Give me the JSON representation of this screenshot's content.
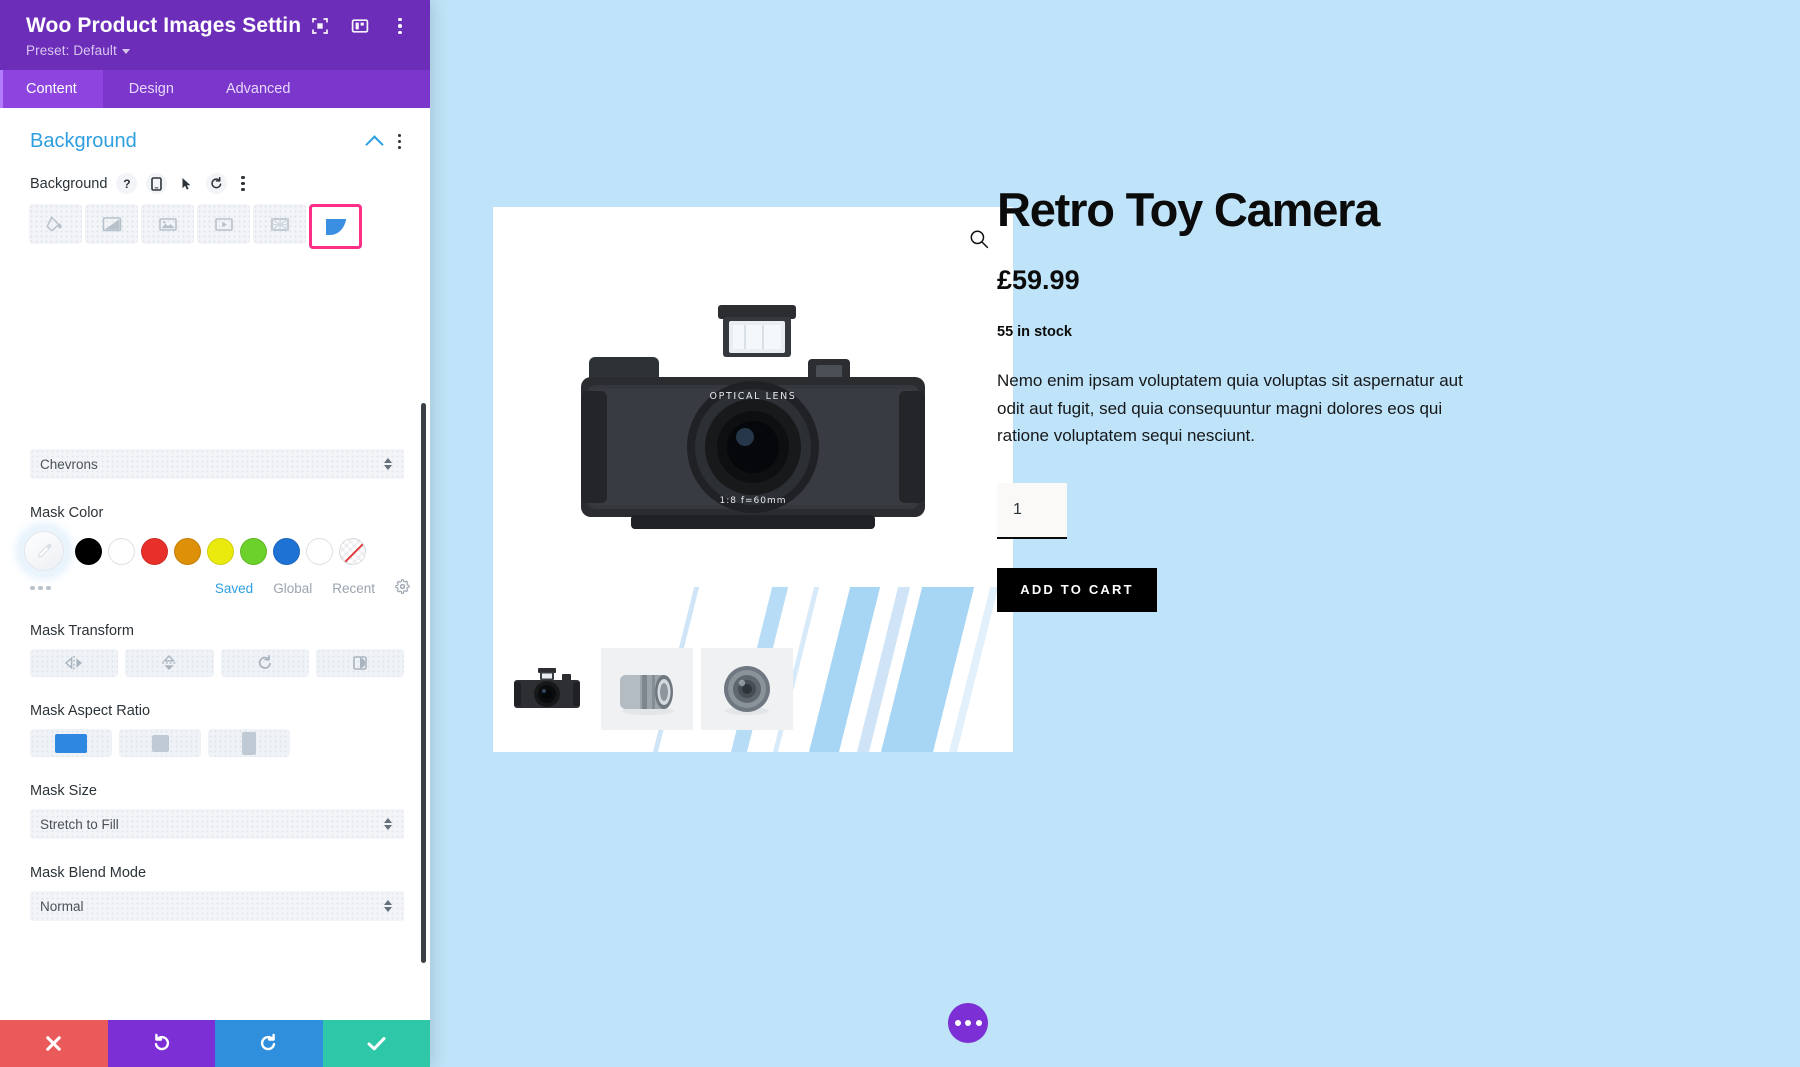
{
  "panel": {
    "title": "Woo Product Images Settin...",
    "preset_label": "Preset: Default",
    "header_icons": [
      "expand-icon",
      "layout-icon",
      "kebab-icon"
    ],
    "tabs": [
      {
        "label": "Content",
        "active": true
      },
      {
        "label": "Design",
        "active": false
      },
      {
        "label": "Advanced",
        "active": false
      }
    ],
    "section": {
      "title": "Background",
      "field_label": "Background",
      "field_icons": [
        "help-icon",
        "responsive-icon",
        "hover-icon",
        "reset-icon",
        "kebab-icon"
      ],
      "background_types": [
        {
          "name": "background-color",
          "active": false
        },
        {
          "name": "background-gradient",
          "active": false
        },
        {
          "name": "background-image",
          "active": false
        },
        {
          "name": "background-video",
          "active": false
        },
        {
          "name": "background-pattern",
          "active": false
        },
        {
          "name": "background-mask",
          "active": true
        }
      ]
    },
    "mask_style": {
      "label": "Chevrons"
    },
    "mask_color": {
      "label": "Mask Color",
      "swatches": [
        {
          "name": "eyedropper",
          "color": "#f2f4f7",
          "selected": true
        },
        {
          "name": "black",
          "color": "#000000"
        },
        {
          "name": "white",
          "color": "#ffffff"
        },
        {
          "name": "red",
          "color": "#e8302a"
        },
        {
          "name": "orange",
          "color": "#dd9008"
        },
        {
          "name": "yellow",
          "color": "#eaea0e"
        },
        {
          "name": "green",
          "color": "#6cd12a"
        },
        {
          "name": "blue",
          "color": "#1e72d4"
        },
        {
          "name": "white-2",
          "color": "#ffffff"
        },
        {
          "name": "transparent",
          "color": "transparent"
        }
      ],
      "tabs": [
        {
          "label": "Saved",
          "active": true
        },
        {
          "label": "Global",
          "active": false
        },
        {
          "label": "Recent",
          "active": false
        }
      ],
      "settings_icon": "gear-icon"
    },
    "mask_transform": {
      "label": "Mask Transform",
      "buttons": [
        "flip-horizontal-icon",
        "flip-vertical-icon",
        "rotate-icon",
        "invert-icon"
      ]
    },
    "mask_aspect_ratio": {
      "label": "Mask Aspect Ratio",
      "options": [
        {
          "name": "landscape",
          "active": true
        },
        {
          "name": "square",
          "active": false
        },
        {
          "name": "portrait",
          "active": false
        }
      ]
    },
    "mask_size": {
      "label": "Mask Size",
      "value": "Stretch to Fill"
    },
    "mask_blend_mode": {
      "label": "Mask Blend Mode",
      "value": "Normal"
    },
    "footer": [
      {
        "name": "discard-button",
        "icon": "close-icon",
        "color": "#eb5a5a"
      },
      {
        "name": "undo-button",
        "icon": "undo-icon",
        "color": "#7b2fd4"
      },
      {
        "name": "redo-button",
        "icon": "redo-icon",
        "color": "#2f8fdc"
      },
      {
        "name": "save-button",
        "icon": "check-icon",
        "color": "#2ec7a8"
      }
    ]
  },
  "canvas": {
    "background_color": "#bfe3f8",
    "gallery": {
      "zoom_icon": "magnifier-icon",
      "thumbnails": [
        "camera-thumb",
        "lens-thumb",
        "lens-cap-thumb"
      ]
    },
    "product": {
      "title": "Retro Toy Camera",
      "price": "£59.99",
      "stock": "55 in stock",
      "description": "Nemo enim ipsam voluptatem quia voluptas sit aspernatur aut odit aut fugit, sed quia consequuntur magni dolores eos qui ratione voluptatem sequi nesciunt.",
      "quantity": "1",
      "add_to_cart": "ADD TO CART"
    },
    "fab": {
      "name": "page-settings-fab",
      "icon": "ellipsis-icon"
    }
  }
}
